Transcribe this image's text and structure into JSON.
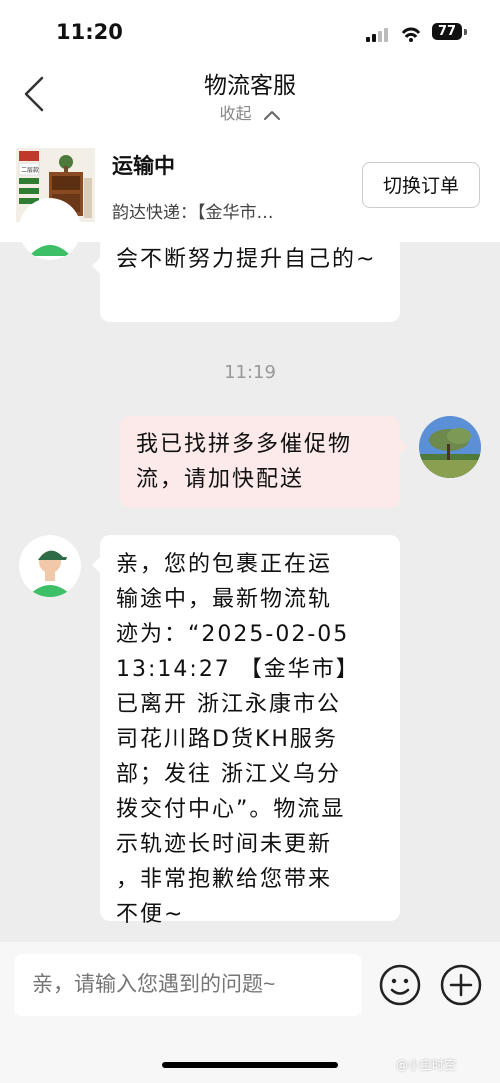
{
  "status": {
    "time": "11:20",
    "battery": "77"
  },
  "nav": {
    "title": "物流客服",
    "collapse_label": "收起"
  },
  "order": {
    "state": "运输中",
    "shipping": "韵达快递：【金华市…",
    "switch_label": "切换订单",
    "thumb_text": "二层款"
  },
  "messages": {
    "partial_text": "会不断努力提升自己的~",
    "timestamp": "11:19",
    "user_msg": "我已找拼多多催促物流，请加快配送",
    "agent_reply_lines": [
      "亲，您的包裹正在运",
      "输途中，最新物流轨",
      "迹为：“2025-02-05",
      "13:14:27 【金华市】",
      "已离开 浙江永康市公",
      "司花川路D货KH服务",
      "部；发往 浙江义乌分",
      "拨交付中心”。物流显",
      "示轨迹长时间未更新",
      "，非常抱歉给您带来",
      "不便~"
    ]
  },
  "input": {
    "placeholder": "亲，请输入您遇到的问题~"
  },
  "icons": [
    "back-icon",
    "chevron-up-icon",
    "emoji-icon",
    "plus-icon",
    "signal-icon",
    "wifi-icon",
    "battery-icon"
  ],
  "watermark": "@小宝时空"
}
